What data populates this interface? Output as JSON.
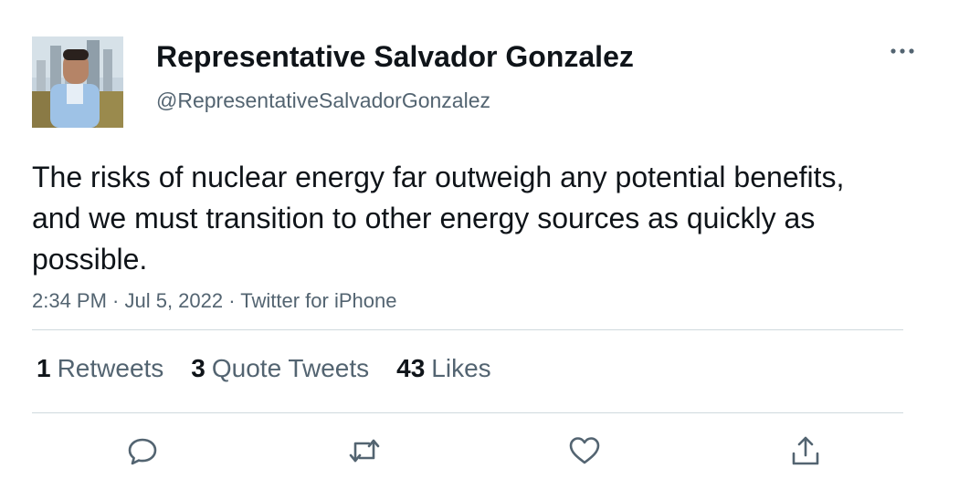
{
  "author": {
    "display_name": "Representative Salvador Gonzalez",
    "handle": "@RepresentativeSalvadorGonzalez"
  },
  "tweet": {
    "text": "The risks of nuclear energy far outweigh any potential benefits, and we must transition to other energy sources as quickly as possible.",
    "meta": "2:34 PM · Jul 5, 2022 · Twitter for iPhone"
  },
  "stats": [
    {
      "count": "1",
      "label": "Retweets"
    },
    {
      "count": "3",
      "label": "Quote Tweets"
    },
    {
      "count": "43",
      "label": "Likes"
    }
  ],
  "icons": {
    "more": "more-horizontal-icon",
    "reply": "reply-bubble-icon",
    "retweet": "retweet-icon",
    "like": "heart-icon",
    "share": "share-icon"
  },
  "colors": {
    "text_primary": "#0f1419",
    "text_secondary": "#536471",
    "divider": "#cfd9de"
  }
}
